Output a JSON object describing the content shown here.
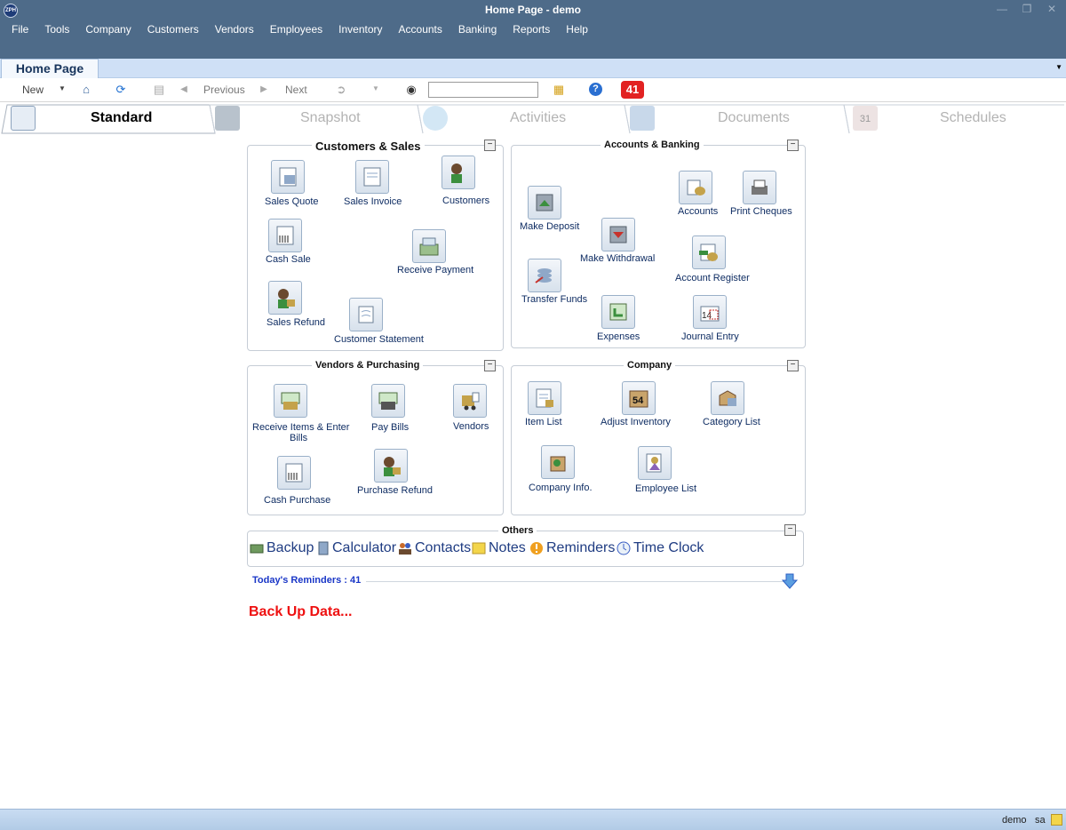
{
  "window": {
    "title": "Home Page - demo",
    "app_icon_text": "ZPH"
  },
  "menu": [
    "File",
    "Tools",
    "Company",
    "Customers",
    "Vendors",
    "Employees",
    "Inventory",
    "Accounts",
    "Banking",
    "Reports",
    "Help"
  ],
  "tab": {
    "label": "Home Page"
  },
  "toolbar": {
    "new_label": "New",
    "previous_label": "Previous",
    "next_label": "Next",
    "search_value": "",
    "badge_count": "41"
  },
  "view_tabs": [
    "Standard",
    "Snapshot",
    "Activities",
    "Documents",
    "Schedules"
  ],
  "customers_sales": {
    "title": "Customers & Sales",
    "items": [
      "Sales Quote",
      "Sales Invoice",
      "Customers",
      "Cash Sale",
      "Receive Payment",
      "Sales Refund",
      "Customer Statement"
    ]
  },
  "accounts_banking": {
    "title": "Accounts & Banking",
    "items": [
      "Make Deposit",
      "Accounts",
      "Print Cheques",
      "Make Withdrawal",
      "Account Register",
      "Transfer Funds",
      "Expenses",
      "Journal Entry"
    ]
  },
  "vendors_purchasing": {
    "title": "Vendors & Purchasing",
    "items": [
      "Receive Items & Enter",
      "Bills",
      "Pay Bills",
      "Vendors",
      "Cash Purchase",
      "Purchase Refund"
    ]
  },
  "company": {
    "title": "Company",
    "items": [
      "Item List",
      "Adjust Inventory",
      "Category List",
      "Company Info.",
      "Employee List"
    ]
  },
  "others": {
    "title": "Others",
    "items": [
      "Backup",
      "Calculator",
      "Contacts",
      "Notes",
      "Reminders",
      "Time Clock"
    ]
  },
  "reminders": {
    "label": "Today's Reminders : 41"
  },
  "backup_message": "Back Up Data...",
  "status": {
    "company": "demo",
    "user": "sa"
  }
}
